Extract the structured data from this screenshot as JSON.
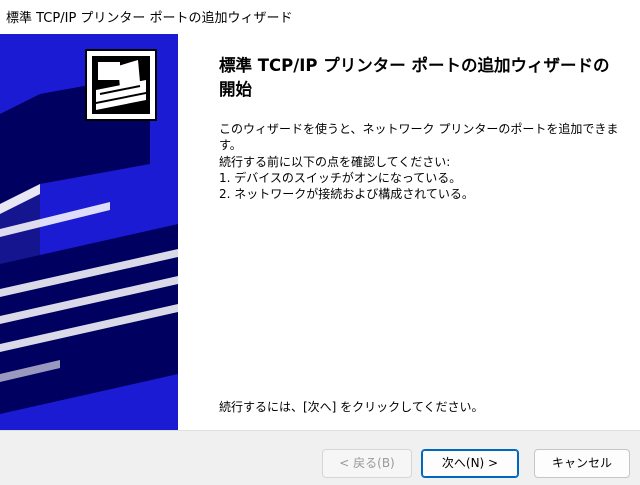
{
  "window": {
    "title": "標準 TCP/IP プリンター ポートの追加ウィザード"
  },
  "banner": {
    "icon": "printer-wizard-icon",
    "colors": {
      "background": "#1b1bd4",
      "dark": "#000060"
    }
  },
  "content": {
    "heading": "標準 TCP/IP プリンター ポートの追加ウィザードの開始",
    "intro": "このウィザードを使うと、ネットワーク プリンターのポートを追加できます。",
    "requirements_intro": "続行する前に以下の点を確認してください:",
    "requirements": [
      "1. デバイスのスイッチがオンになっている。",
      "2. ネットワークが接続および構成されている。"
    ],
    "continue_note": "続行するには、[次へ] をクリックしてください。"
  },
  "footer": {
    "back_label": "< 戻る(B)",
    "next_label": "次へ(N) >",
    "cancel_label": "キャンセル"
  },
  "colors": {
    "accent": "#0067c0"
  }
}
